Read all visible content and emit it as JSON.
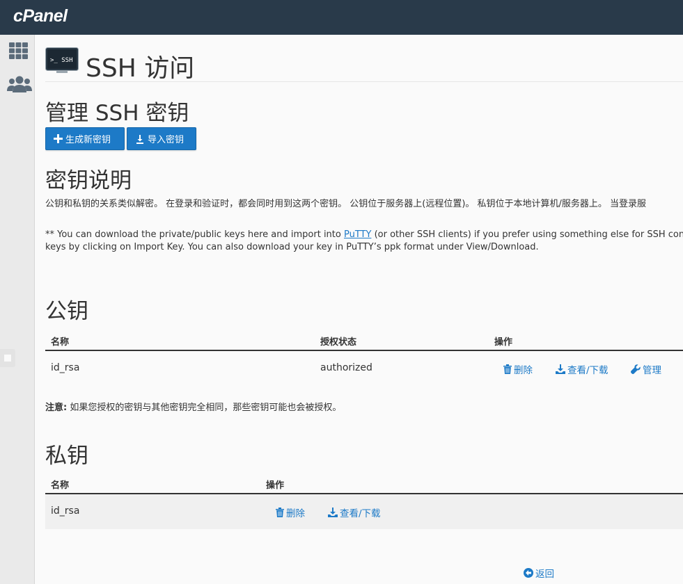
{
  "header": {
    "logo": "cPanel"
  },
  "sidebar": {
    "items": [
      {
        "icon": "grid-icon"
      },
      {
        "icon": "users-icon"
      }
    ]
  },
  "page": {
    "title": "SSH 访问",
    "icon_text": ">_ SSH"
  },
  "manage": {
    "heading": "管理 SSH 密钥",
    "generate_label": "生成新密钥",
    "import_label": "导入密钥"
  },
  "description": {
    "heading": "密钥说明",
    "line1": "公钥和私钥的关系类似解密。 在登录和验证时，都会同时用到这两个密钥。 公钥位于服务器上(远程位置)。 私钥位于本地计算机/服务器上。 当登录服",
    "line2_pre": "** You can download the private/public keys here and import into ",
    "putty_link": "PuTTY",
    "line2_post": " (or other SSH clients) if you prefer using something else for SSH con",
    "line3": "keys by clicking on Import Key. You can also download your key in PuTTY’s ppk format under View/Download."
  },
  "public_keys": {
    "heading": "公钥",
    "columns": [
      "名称",
      "授权状态",
      "操作"
    ],
    "rows": [
      {
        "name": "id_rsa",
        "status": "authorized",
        "delete": "删除",
        "view": "查看/下载",
        "manage": "管理"
      }
    ]
  },
  "note": {
    "label": "注意:",
    "text": " 如果您授权的密钥与其他密钥完全相同，那些密钥可能也会被授权。"
  },
  "private_keys": {
    "heading": "私钥",
    "columns": [
      "名称",
      "操作"
    ],
    "rows": [
      {
        "name": "id_rsa",
        "delete": "删除",
        "view": "查看/下载"
      }
    ]
  },
  "back_label": "返回",
  "colors": {
    "topbar": "#293a4a",
    "accent": "#1d7ac7",
    "sidebar": "#eaeaea"
  }
}
